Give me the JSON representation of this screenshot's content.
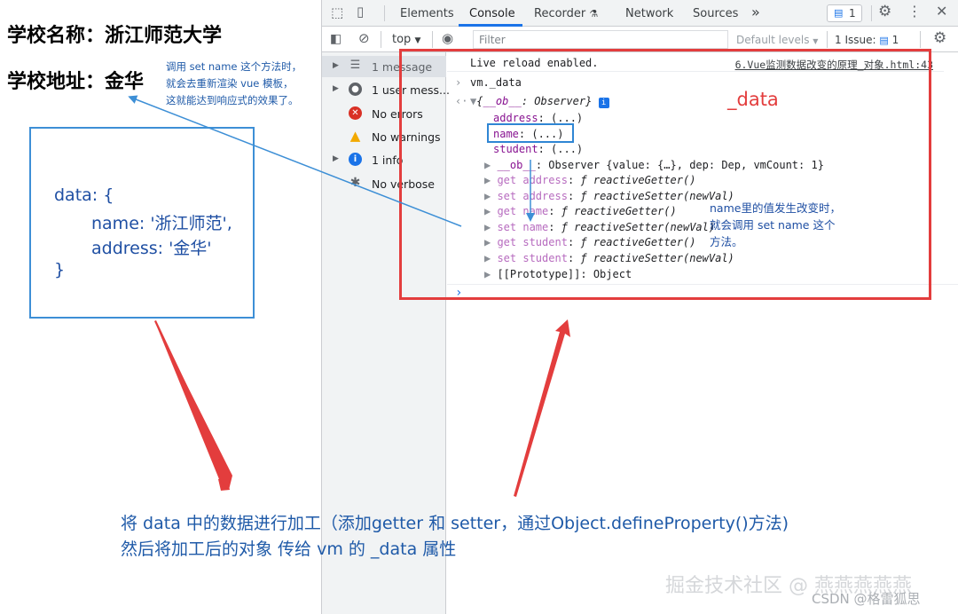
{
  "page": {
    "school_name": "学校名称：浙江师范大学",
    "school_address": "学校地址：金华",
    "set_note_lines": [
      "调用 set name 这个方法时，",
      "就会去重新渲染 vue 模板，",
      "这就能达到响应式的效果了。"
    ],
    "data_box_lines": [
      "data: {",
      "name: '浙江师范',",
      "address: '金华'",
      "}"
    ]
  },
  "devtools": {
    "tabs": [
      "Elements",
      "Console",
      "Recorder",
      "Network",
      "Sources"
    ],
    "active_tab": "Console",
    "more_tabs": "»",
    "messages_badge": "1",
    "context": "top",
    "filter_placeholder": "Filter",
    "default_levels": "Default levels",
    "issues_label": "1 Issue:",
    "issues_count": "1",
    "sidebar": [
      {
        "label": "1 message",
        "icon": "list-icon",
        "color": "#5f6368",
        "expandable": true
      },
      {
        "label": "1 user mess...",
        "icon": "user-icon",
        "color": "#5f6368",
        "expandable": true
      },
      {
        "label": "No errors",
        "icon": "error-icon",
        "color": "#d93025",
        "expandable": false
      },
      {
        "label": "No warnings",
        "icon": "warning-icon",
        "color": "#f2a900",
        "expandable": false
      },
      {
        "label": "1 info",
        "icon": "info-icon",
        "color": "#1a73e8",
        "expandable": true
      },
      {
        "label": "No verbose",
        "icon": "verbose-icon",
        "color": "#5f6368",
        "expandable": false
      }
    ],
    "console": {
      "live_reload": "Live reload enabled.",
      "source_link": "6.Vue监测数据改变的原理_对象.html:43",
      "command": "vm._data",
      "result_header_pre": "{",
      "result_header_ob": "__ob__",
      "result_header_post": ": Observer}",
      "props": [
        {
          "key": "address",
          "value": "(...)"
        },
        {
          "key": "name",
          "value": "(...)"
        },
        {
          "key": "student",
          "value": "(...)"
        }
      ],
      "ob_key": "__ob__",
      "ob_value": ": Observer {value: {…}, dep: Dep, vmCount: 1}",
      "accessors": [
        {
          "key": "get address",
          "fn": "reactiveGetter()"
        },
        {
          "key": "set address",
          "fn": "reactiveSetter(newVal)"
        },
        {
          "key": "get name",
          "fn": "reactiveGetter()"
        },
        {
          "key": "set name",
          "fn": "reactiveSetter(newVal)"
        },
        {
          "key": "get student",
          "fn": "reactiveGetter()"
        },
        {
          "key": "set student",
          "fn": "reactiveSetter(newVal)"
        }
      ],
      "prototype": "[[Prototype]]: Object",
      "prompt": "›"
    }
  },
  "annotations": {
    "data_label": "_data",
    "name_note_lines": [
      "name里的值发生改变时，",
      "就会调用 set name 这个",
      "方法。"
    ],
    "bottom_lines": [
      "将 data 中的数据进行加工（添加getter 和 setter，通过Object.defineProperty()方法)",
      "然后将加工后的对象 传给 vm 的 _data 属性"
    ],
    "watermark_main": "掘金技术社区 @ 燕燕燕燕燕",
    "watermark_csdn": "CSDN @格雷狐思",
    "colors": {
      "red": "#e33d3d",
      "blue": "#2f86d4",
      "text_blue": "#1f4fa3"
    }
  }
}
